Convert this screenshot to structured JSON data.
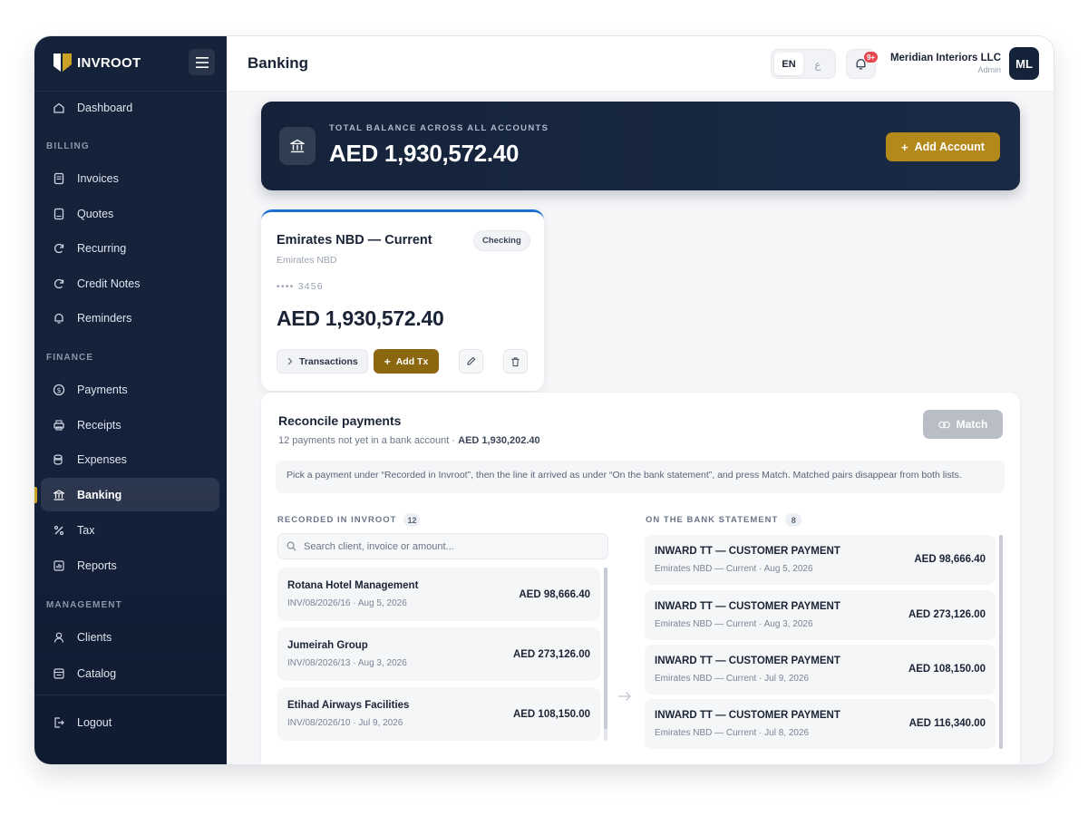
{
  "brand": {
    "name": "INVROOT"
  },
  "sidebar": {
    "items_top": [
      {
        "label": "Dashboard",
        "icon": "home-icon"
      }
    ],
    "sections": [
      {
        "title": "BILLING",
        "items": [
          {
            "label": "Invoices",
            "icon": "document-icon"
          },
          {
            "label": "Quotes",
            "icon": "quote-icon"
          },
          {
            "label": "Recurring",
            "icon": "refresh-icon"
          },
          {
            "label": "Credit Notes",
            "icon": "refresh-icon"
          },
          {
            "label": "Reminders",
            "icon": "bell-icon"
          }
        ]
      },
      {
        "title": "FINANCE",
        "items": [
          {
            "label": "Payments",
            "icon": "dollar-icon"
          },
          {
            "label": "Receipts",
            "icon": "printer-icon"
          },
          {
            "label": "Expenses",
            "icon": "coins-icon"
          },
          {
            "label": "Banking",
            "icon": "bank-icon"
          },
          {
            "label": "Tax",
            "icon": "percent-icon"
          },
          {
            "label": "Reports",
            "icon": "chart-icon"
          }
        ]
      },
      {
        "title": "MANAGEMENT",
        "items": [
          {
            "label": "Clients",
            "icon": "user-icon"
          },
          {
            "label": "Catalog",
            "icon": "catalog-icon"
          }
        ]
      }
    ],
    "logout": "Logout",
    "active": "Banking"
  },
  "header": {
    "title": "Banking",
    "lang_en": "EN",
    "lang_ar": "ع",
    "notifications_badge": "9+",
    "company": "Meridian Interiors LLC",
    "role": "Admin",
    "avatar_initials": "ML"
  },
  "balance": {
    "label": "TOTAL BALANCE ACROSS ALL ACCOUNTS",
    "value": "AED 1,930,572.40",
    "add_account": "Add Account"
  },
  "account": {
    "name": "Emirates NBD — Current",
    "bank": "Emirates NBD",
    "type": "Checking",
    "masked": "•••• 3456",
    "balance": "AED 1,930,572.40",
    "transactions_label": "Transactions",
    "add_tx_label": "Add Tx"
  },
  "reconcile": {
    "title": "Reconcile payments",
    "subtitle": "12 payments not yet in a bank account ·",
    "subtitle_amount": "AED 1,930,202.40",
    "match_label": "Match",
    "hint": "Pick a payment under “Recorded in Invroot”, then the line it arrived as under “On the bank statement”, and press Match. Matched pairs disappear from both lists.",
    "left_header": "RECORDED IN INVROOT",
    "left_count": "12",
    "right_header": "ON THE BANK STATEMENT",
    "right_count": "8",
    "search_placeholder": "Search client, invoice or amount...",
    "recorded": [
      {
        "client": "Rotana Hotel Management",
        "meta": "INV/08/2026/16 · Aug 5, 2026",
        "amount": "AED 98,666.40"
      },
      {
        "client": "Jumeirah Group",
        "meta": "INV/08/2026/13 · Aug 3, 2026",
        "amount": "AED 273,126.00"
      },
      {
        "client": "Etihad Airways Facilities",
        "meta": "INV/08/2026/10 · Jul 9, 2026",
        "amount": "AED 108,150.00"
      }
    ],
    "statement": [
      {
        "title": "INWARD TT — CUSTOMER PAYMENT",
        "meta": "Emirates NBD — Current · Aug 5, 2026",
        "amount": "AED 98,666.40"
      },
      {
        "title": "INWARD TT — CUSTOMER PAYMENT",
        "meta": "Emirates NBD — Current · Aug 3, 2026",
        "amount": "AED 273,126.00"
      },
      {
        "title": "INWARD TT — CUSTOMER PAYMENT",
        "meta": "Emirates NBD — Current · Jul 9, 2026",
        "amount": "AED 108,150.00"
      },
      {
        "title": "INWARD TT — CUSTOMER PAYMENT",
        "meta": "Emirates NBD — Current · Jul 8, 2026",
        "amount": "AED 116,340.00"
      }
    ]
  },
  "colors": {
    "navy": "#15233a",
    "gold": "#b3891b",
    "accent_blue": "#1f6fd0"
  }
}
